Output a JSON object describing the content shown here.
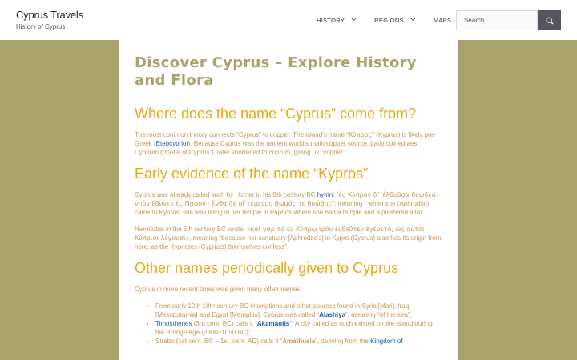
{
  "header": {
    "site_title": "Cyprus Travels",
    "site_description": "History of Cyprus",
    "nav": [
      {
        "label": "HISTORY",
        "has_dropdown": true
      },
      {
        "label": "REGIONS",
        "has_dropdown": true
      },
      {
        "label": "MAPS",
        "has_dropdown": false
      }
    ],
    "search": {
      "placeholder": "Search …"
    }
  },
  "article": {
    "title": "Discover Cyprus – Explore History and Flora",
    "section1": {
      "heading": "Where does the name “Cyprus” come from?",
      "p1_a": "The most common theory connects “Cyprus” to copper. The island’s name “",
      "p1_greek": "Κύπρος",
      "p1_b": "” (Kypros) is likely pre-Greek (",
      "p1_link": "Eteocypriot",
      "p1_c": "). Because Cyprus was the ancient world’s main copper source, Latin coined aes Cyprium (“metal of Cyprus”), later shortened to cuprum, giving us “copper”."
    },
    "section2": {
      "heading": "Early evidence of the name “Kypros”",
      "p1_a": "Cyprus was already called such by Homer in his 8th century BC ",
      "p1_link": "hymn",
      "p1_b": ": “",
      "p1_greek": "ἐς Κύπρον δ᾽ ἐλθοῦσα θυώδεα νηὸν ἔδυνεν ἐς Πάφον · ἔνθα δέ οἱ τέμενος βωμός τε θυώδης",
      "p1_c": "”, meaning “ when she (Aphrodite) came to Kypros, she was living in her temple in Paphos where she had a temple and a plastered altar”.",
      "p2_a": "Herodotus in the 5th century BC wrote: «",
      "p2_greek": "καὶ γὰρ τὸ ἐν Κύπρῳ ἱρὸν ἐνθεῦτεν ἐγένετο, ὡς αὐτοὶ Κύπριοι λέγουσι",
      "p2_b": "», meaning “because her sanctuary [Aphrodite’s] in Kypro (Cyprus) also has its origin from here, as the Kypriotes (Cypriots) themselves confess”."
    },
    "section3": {
      "heading": "Other names periodically given to Cyprus",
      "intro": "Cyprus in more recent times was given many other names.",
      "items": [
        {
          "pre": "From early 19th-18th century BC inscriptions and other sources found in Syria [Mari], Iraq [Mesopotamia] and Egypt [Memphis], Cyprus was called “",
          "name": "Alashiya",
          "post": "”, meaning “of the sea”;"
        },
        {
          "link": "Timosthenes",
          "pre": " (3rd cent. BC) calls it “",
          "name": "Akamantis",
          "post": "”. A city called as such existed on the island during the Bronge Age (2300–1050 BC);"
        },
        {
          "pre": "Strabo (1st cent. BC – 1st. cent. AD) calls it “",
          "name": "Amathusia",
          "post": "”, deriving from the ",
          "link2": "Kingdom of"
        }
      ]
    }
  },
  "colors": {
    "background": "#a8a46c",
    "heading": "#e8a814",
    "body_text": "#c89550",
    "link": "#1f5fb0",
    "search_button": "#55555e"
  }
}
